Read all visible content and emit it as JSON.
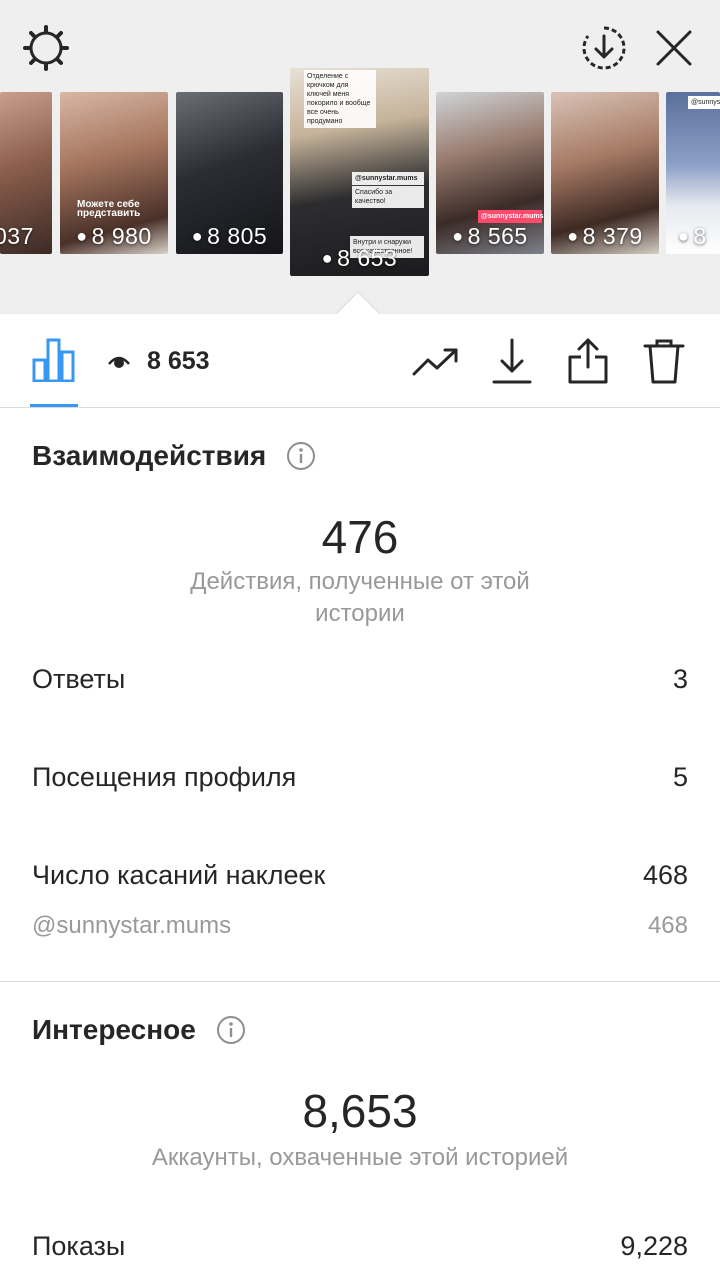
{
  "stories": [
    {
      "views": "037"
    },
    {
      "views": "8 980"
    },
    {
      "views": "8 805"
    },
    {
      "views": "8 653"
    },
    {
      "views": "8 565"
    },
    {
      "views": "8 379"
    },
    {
      "views": "8"
    }
  ],
  "story_captions": {
    "t2": "Можете себе представить",
    "t4_top": "Отделение с крючком для ключей меня покорило и вообще все очень продумано",
    "t4_sticker": "@sunnystar.mums",
    "t4_thanks": "Спасибо за качество!",
    "t4_bottom": "Внутри и снаружи все качественное!",
    "t5_sticker": "@sunnystar.mums",
    "t7_tag": "@sunnys"
  },
  "toolbar": {
    "view_count": "8 653"
  },
  "interactions": {
    "title": "Взаимодействия",
    "total": "476",
    "total_desc": "Действия, полученные от этой истории",
    "rows": [
      {
        "label": "Ответы",
        "value": "3"
      },
      {
        "label": "Посещения профиля",
        "value": "5"
      },
      {
        "label": "Число касаний наклеек",
        "value": "468"
      }
    ],
    "sticker": {
      "label": "@sunnystar.mums",
      "value": "468"
    }
  },
  "discovery": {
    "title": "Интересное",
    "total": "8,653",
    "total_desc": "Аккаунты, охваченные этой историей",
    "rows": [
      {
        "label": "Показы",
        "value": "9,228"
      }
    ]
  },
  "colors": {
    "accent": "#3897f0",
    "text": "#262626",
    "muted": "#999999",
    "strip_bg": "#efefef"
  },
  "icons": [
    "settings-gear-icon",
    "download-circle-icon",
    "close-icon",
    "bar-chart-icon",
    "eye-icon",
    "trending-icon",
    "download-icon",
    "share-icon",
    "trash-icon",
    "info-icon"
  ]
}
